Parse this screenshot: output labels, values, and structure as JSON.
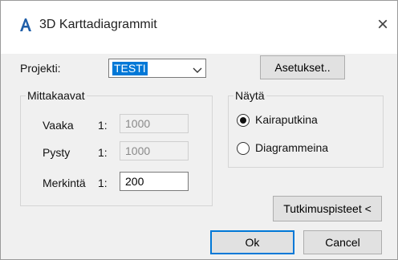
{
  "window": {
    "title": "3D Karttadiagrammit",
    "close_glyph": "×",
    "app_icon": "autocad-a-icon"
  },
  "project": {
    "label": "Projekti:",
    "selected": "TESTI"
  },
  "buttons": {
    "settings": "Asetukset..",
    "survey_points": "Tutkimuspisteet <",
    "ok": "Ok",
    "cancel": "Cancel"
  },
  "scales": {
    "title": "Mittakaavat",
    "rows": [
      {
        "label": "Vaaka",
        "prefix": "1:",
        "value": "1000",
        "enabled": false
      },
      {
        "label": "Pysty",
        "prefix": "1:",
        "value": "1000",
        "enabled": false
      },
      {
        "label": "Merkintä",
        "prefix": "1:",
        "value": "200",
        "enabled": true
      }
    ]
  },
  "display": {
    "title": "Näytä",
    "options": [
      {
        "label": "Kairaputkina",
        "checked": true
      },
      {
        "label": "Diagrammeina",
        "checked": false
      }
    ]
  },
  "colors": {
    "accent": "#0078d7",
    "icon_blue": "#1f5ea8"
  }
}
